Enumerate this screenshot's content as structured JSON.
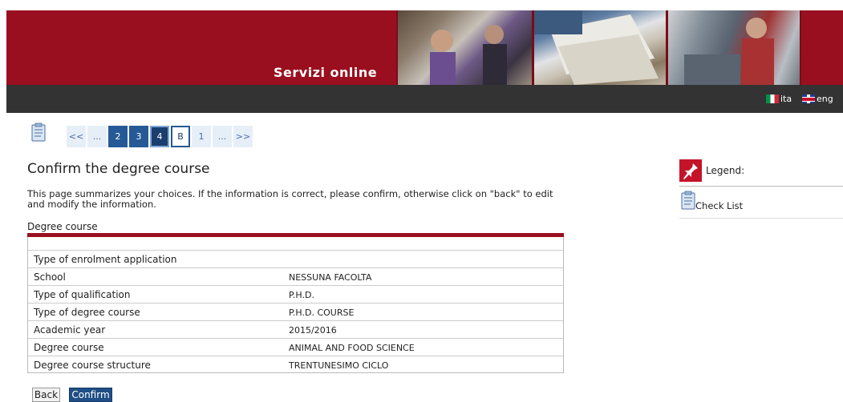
{
  "header": {
    "brand": "Servizi online"
  },
  "languages": [
    {
      "label": "ita"
    },
    {
      "label": "eng"
    }
  ],
  "pager": {
    "items": [
      "<<",
      "...",
      "2",
      "3",
      "4",
      "B",
      "1",
      "...",
      ">>"
    ],
    "current": "4"
  },
  "page": {
    "title": "Confirm the degree course",
    "description": "This page summarizes your choices. If the information is correct, please confirm, otherwise click on \"back\" to edit and modify the information.",
    "section_label": "Degree course"
  },
  "table": {
    "header_row": "Type of enrolment application",
    "rows": [
      {
        "key": "School",
        "value": "NESSUNA FACOLTA"
      },
      {
        "key": "Type of qualification",
        "value": "P.H.D."
      },
      {
        "key": "Type of degree course",
        "value": "P.H.D. COURSE"
      },
      {
        "key": "Academic year",
        "value": "2015/2016"
      },
      {
        "key": "Degree course",
        "value": "ANIMAL AND FOOD SCIENCE"
      },
      {
        "key": "Degree course structure",
        "value": "TRENTUNESIMO CICLO"
      }
    ]
  },
  "buttons": {
    "back": "Back",
    "confirm": "Confirm"
  },
  "legend": {
    "title": "Legend:",
    "items": [
      {
        "label": "Check List",
        "icon": "clipboard-icon"
      }
    ]
  },
  "colors": {
    "brand_red": "#9a0f1f",
    "topbar": "#333333",
    "pager_active": "#255a97",
    "button_primary": "#1f4f86"
  }
}
